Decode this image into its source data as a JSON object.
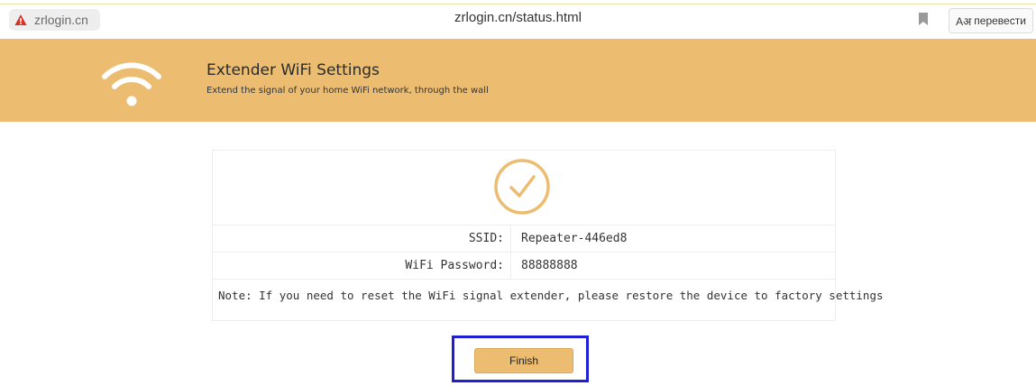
{
  "browser": {
    "site_chip_label": "zrlogin.cn",
    "url": "zrlogin.cn/status.html",
    "translate_label": "перевести",
    "translate_glyph": "Aअ"
  },
  "banner": {
    "title": "Extender WiFi Settings",
    "subtitle": "Extend the signal of your home WiFi network, through the wall",
    "background_color": "#ecbd70",
    "icon": "wifi-icon"
  },
  "status": {
    "icon": "check-circle-icon",
    "rows": [
      {
        "label": "SSID:",
        "value": "Repeater-446ed8"
      },
      {
        "label": "WiFi Password:",
        "value": "88888888"
      }
    ],
    "note": "Note: If you need to reset the WiFi signal extender, please restore the device to factory settings"
  },
  "actions": {
    "finish_label": "Finish"
  }
}
